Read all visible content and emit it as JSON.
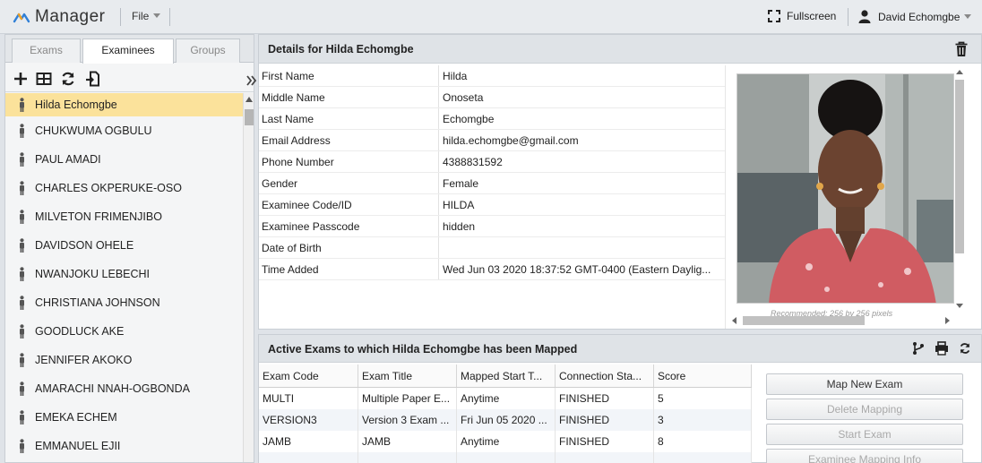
{
  "app": {
    "title": "Manager"
  },
  "header": {
    "file_label": "File",
    "fullscreen_label": "Fullscreen",
    "user_name": "David Echomgbe"
  },
  "tabs": [
    "Exams",
    "Examinees",
    "Groups"
  ],
  "active_tab": "Examinees",
  "examinees": [
    "Hilda Echomgbe",
    "CHUKWUMA OGBULU",
    "PAUL AMADI",
    "CHARLES OKPERUKE-OSO",
    "MILVETON FRIMENJIBO",
    "DAVIDSON OHELE",
    "NWANJOKU LEBECHI",
    "CHRISTIANA JOHNSON",
    "GOODLUCK AKE",
    "JENNIFER AKOKO",
    "AMARACHI NNAH-OGBONDA",
    "EMEKA ECHEM",
    "EMMANUEL EJII"
  ],
  "details": {
    "title": "Details for Hilda Echomgbe",
    "fields": [
      {
        "label": "First Name",
        "value": "Hilda"
      },
      {
        "label": "Middle Name",
        "value": "Onoseta"
      },
      {
        "label": "Last Name",
        "value": "Echomgbe"
      },
      {
        "label": "Email Address",
        "value": "hilda.echomgbe@gmail.com"
      },
      {
        "label": "Phone Number",
        "value": "4388831592"
      },
      {
        "label": "Gender",
        "value": "Female"
      },
      {
        "label": "Examinee Code/ID",
        "value": "HILDA"
      },
      {
        "label": "Examinee Passcode",
        "value": "hidden"
      },
      {
        "label": "Date of Birth",
        "value": ""
      },
      {
        "label": "Time Added",
        "value": "Wed Jun 03 2020 18:37:52 GMT-0400 (Eastern Daylig..."
      }
    ],
    "photo_caption": "Recommended: 256 by 256 pixels"
  },
  "exams": {
    "title": "Active Exams to which Hilda Echomgbe has been Mapped",
    "columns": [
      "Exam Code",
      "Exam Title",
      "Mapped Start T...",
      "Connection Sta...",
      "Score"
    ],
    "rows": [
      [
        "MULTI",
        "Multiple Paper E...",
        "Anytime",
        "FINISHED",
        "5"
      ],
      [
        "VERSION3",
        "Version 3 Exam ...",
        "Fri Jun 05 2020 ...",
        "FINISHED",
        "3"
      ],
      [
        "JAMB",
        "JAMB",
        "Anytime",
        "FINISHED",
        "8"
      ]
    ],
    "actions": [
      {
        "label": "Map New Exam",
        "enabled": true
      },
      {
        "label": "Delete Mapping",
        "enabled": false
      },
      {
        "label": "Start Exam",
        "enabled": false
      },
      {
        "label": "Examinee Mapping Info",
        "enabled": false
      }
    ]
  },
  "colors": {
    "selected_row": "#fbe29b",
    "header_bg": "#dfe3e7",
    "accent_logo": "#2f7fd6"
  }
}
